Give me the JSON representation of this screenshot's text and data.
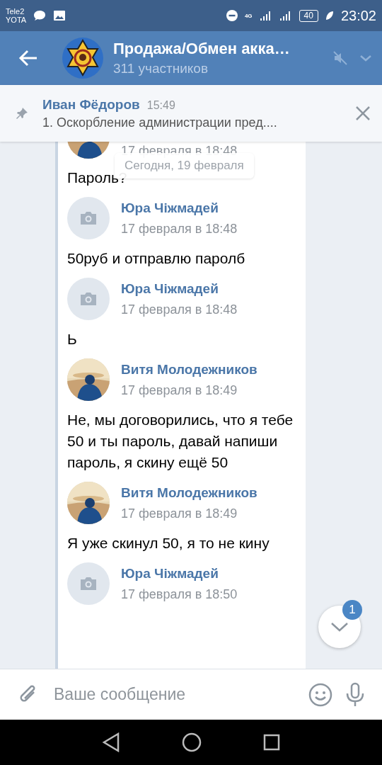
{
  "status_bar": {
    "carrier_1": "Tele2",
    "carrier_2": "YOTA",
    "battery": "40",
    "time": "23:02",
    "network": "4G"
  },
  "header": {
    "title": "Продажа/Обмен акка…",
    "subtitle": "311 участников",
    "muted": true
  },
  "pinned": {
    "author": "Иван Фёдоров",
    "time": "15:49",
    "text": "1. Оскорбление администрации пред...."
  },
  "date_divider": "Сегодня, 19 февраля",
  "messages": [
    {
      "kind": "cut",
      "date": "17 февраля в 18:48",
      "text": "Пароль?"
    },
    {
      "kind": "full",
      "avatar": {
        "kind": "placeholder"
      },
      "author": "Юра Чiжмадей",
      "date": "17 февраля в 18:48",
      "text": "50руб и отправлю паролб"
    },
    {
      "kind": "full",
      "avatar": {
        "kind": "placeholder"
      },
      "author": "Юра Чiжмадей",
      "date": "17 февраля в 18:48",
      "text": "Ь"
    },
    {
      "kind": "full",
      "author": "Витя Молодежников",
      "date": "17 февраля в 18:49",
      "text": "Не, мы договорились, что я тебе 50 и ты пароль, давай напиши пароль, я скину ещё 50"
    },
    {
      "kind": "full",
      "author": "Витя Молодежников",
      "date": "17 февраля в 18:49",
      "text": "Я уже скинул 50, я то не кину"
    },
    {
      "kind": "full",
      "avatar": {
        "kind": "placeholder"
      },
      "author": "Юра Чiжмадей",
      "date": "17 февраля в 18:50"
    }
  ],
  "scroll_button": {
    "badge": "1"
  },
  "composer": {
    "placeholder": "Ваше сообщение"
  }
}
